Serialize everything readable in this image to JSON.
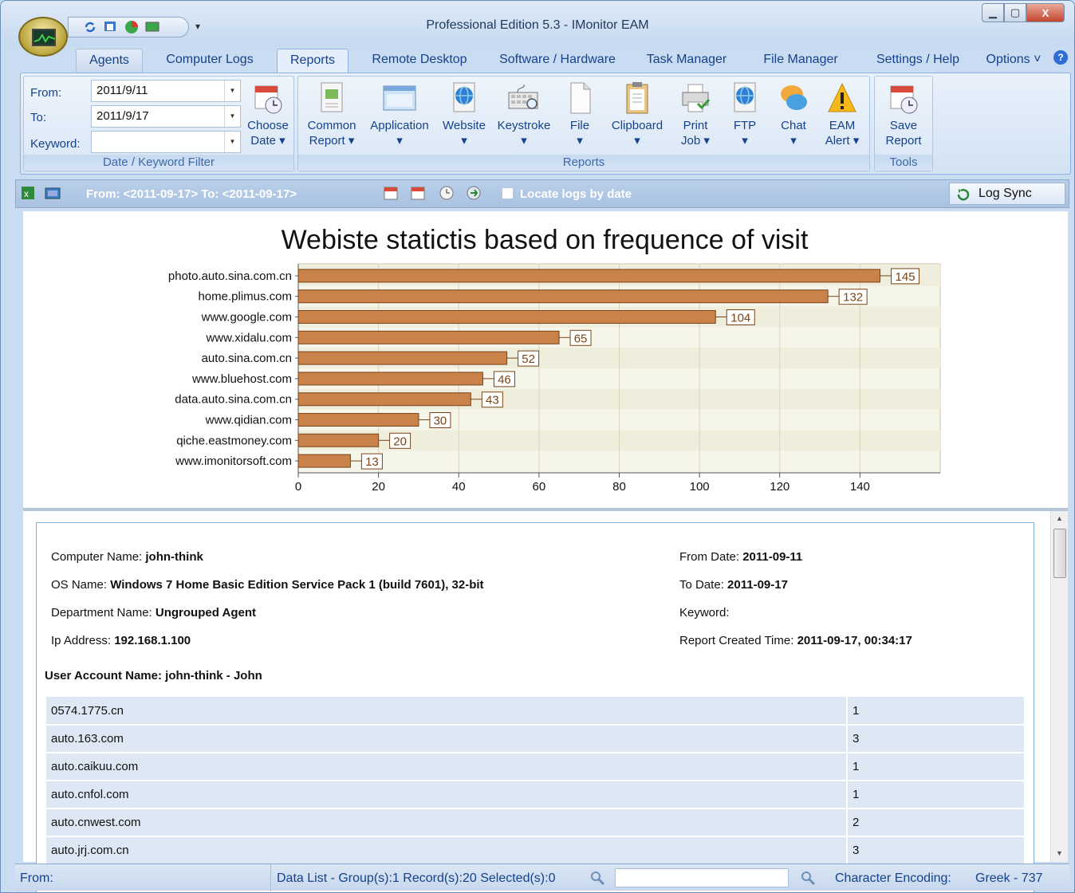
{
  "window": {
    "title": "Professional Edition 5.3 - IMonitor EAM",
    "min_label": "▁",
    "max_label": "▢",
    "close_label": "X"
  },
  "quick_access": {
    "icons": [
      "refresh-icon",
      "agents-settings-icon",
      "chart-icon",
      "monitor-icon"
    ],
    "dropdown": "▾"
  },
  "tabs": [
    {
      "label": "Agents"
    },
    {
      "label": "Computer Logs"
    },
    {
      "label": "Reports"
    },
    {
      "label": "Remote Desktop"
    },
    {
      "label": "Software / Hardware"
    },
    {
      "label": "Task Manager"
    },
    {
      "label": "File Manager"
    },
    {
      "label": "Settings / Help"
    },
    {
      "label": "Options ˅"
    }
  ],
  "filter": {
    "from_label": "From:",
    "from_value": "2011/9/11",
    "to_label": "To:",
    "to_value": "2011/9/17",
    "keyword_label": "Keyword:",
    "keyword_value": "",
    "choose_date_line1": "Choose",
    "choose_date_line2": "Date ▾",
    "group_caption": "Date / Keyword Filter"
  },
  "reports_group": {
    "caption": "Reports",
    "buttons": [
      {
        "l1": "Common",
        "l2": "Report ▾"
      },
      {
        "l1": "Application",
        "l2": "▾"
      },
      {
        "l1": "Website",
        "l2": "▾"
      },
      {
        "l1": "Keystroke",
        "l2": "▾"
      },
      {
        "l1": "File",
        "l2": "▾"
      },
      {
        "l1": "Clipboard",
        "l2": "▾"
      },
      {
        "l1": "Print",
        "l2": "Job ▾"
      },
      {
        "l1": "FTP",
        "l2": "▾"
      },
      {
        "l1": "Chat",
        "l2": "▾"
      },
      {
        "l1": "EAM",
        "l2": "Alert ▾"
      }
    ]
  },
  "tools_group": {
    "caption": "Tools",
    "save_l1": "Save",
    "save_l2": "Report"
  },
  "toolbar": {
    "range_text": "From: <2011-09-17> To: <2011-09-17>",
    "locate_label": "Locate logs by date",
    "log_sync": "Log Sync"
  },
  "chart_data": {
    "type": "bar",
    "orientation": "horizontal",
    "title": "Webiste statictis based on frequence of visit",
    "categories": [
      "photo.auto.sina.com.cn",
      "home.plimus.com",
      "www.google.com",
      "www.xidalu.com",
      "auto.sina.com.cn",
      "www.bluehost.com",
      "data.auto.sina.com.cn",
      "www.qidian.com",
      "qiche.eastmoney.com",
      "www.imonitorsoft.com"
    ],
    "values": [
      145,
      132,
      104,
      65,
      52,
      46,
      43,
      30,
      20,
      13
    ],
    "xlim": [
      0,
      160
    ],
    "xticks": [
      "0",
      "20",
      "40",
      "60",
      "80",
      "100",
      "120",
      "140"
    ],
    "bar_color": "#c8824a",
    "grid": true
  },
  "report": {
    "computer_name_label": "Computer Name: ",
    "computer_name": "john-think",
    "os_label": "OS Name: ",
    "os": "Windows 7 Home Basic Edition Service Pack 1 (build 7601), 32-bit",
    "dept_label": "Department Name: ",
    "dept": "Ungrouped Agent",
    "ip_label": "Ip Address: ",
    "ip": "192.168.1.100",
    "from_label": "From Date: ",
    "from": "2011-09-11",
    "to_label": "To Date: ",
    "to": "2011-09-17",
    "keyword_label": "Keyword:",
    "created_label": "Report Created Time: ",
    "created": "2011-09-17, 00:34:17",
    "user_account": "User Account Name: john-think - John",
    "rows": [
      {
        "site": "0574.1775.cn",
        "count": "1"
      },
      {
        "site": "auto.163.com",
        "count": "3"
      },
      {
        "site": "auto.caikuu.com",
        "count": "1"
      },
      {
        "site": "auto.cnfol.com",
        "count": "1"
      },
      {
        "site": "auto.cnwest.com",
        "count": "2"
      },
      {
        "site": "auto.jrj.com.cn",
        "count": "3"
      }
    ]
  },
  "status": {
    "from": "From:",
    "data_list": "Data List - Group(s):1  Record(s):20  Selected(s):0",
    "encoding_label": "Character Encoding:",
    "encoding_value": "Greek - 737"
  }
}
